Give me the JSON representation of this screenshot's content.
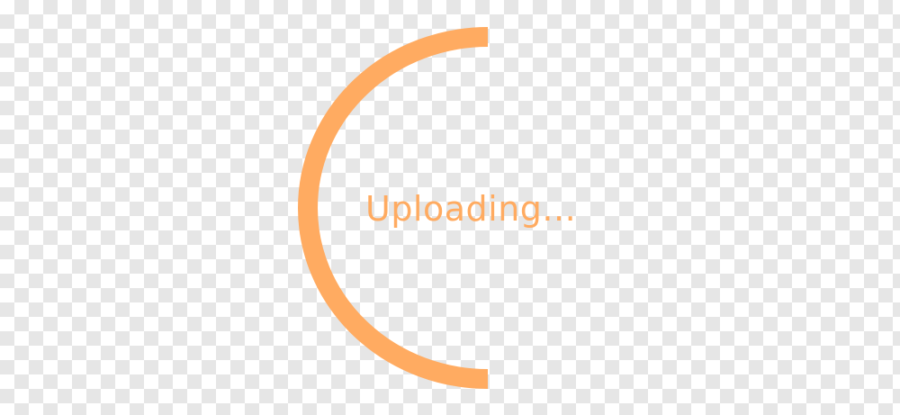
{
  "status": {
    "text": "Uploading...",
    "color": "#ffab61"
  },
  "spinner": {
    "color": "#ffab61",
    "name": "loading-spinner"
  }
}
